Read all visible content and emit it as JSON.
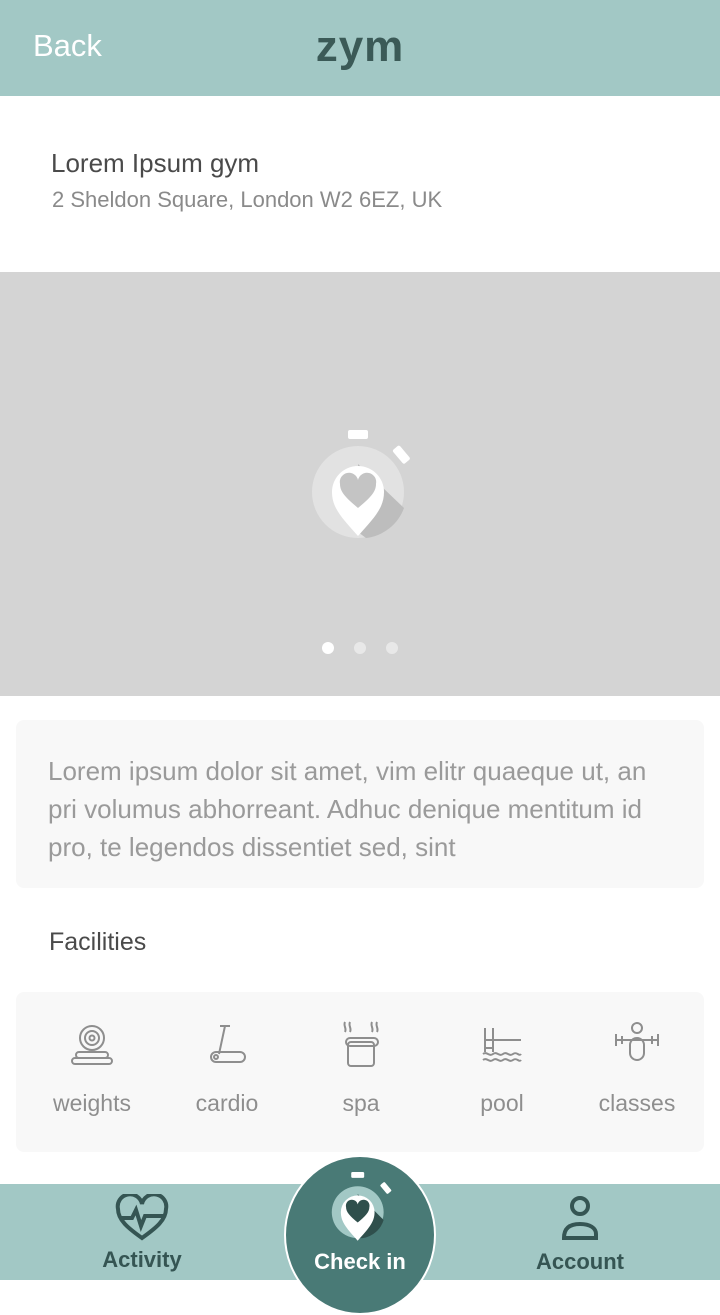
{
  "header": {
    "back_label": "Back",
    "logo": "zym"
  },
  "gym": {
    "name": "Lorem Ipsum gym",
    "address": "2 Sheldon Square, London W2 6EZ, UK"
  },
  "carousel": {
    "icon": "stopwatch-heart-pin-icon",
    "slide_count": 3,
    "active_slide": 1
  },
  "description": "Lorem ipsum dolor sit amet, vim elitr quaeque ut, an pri volumus abhorreant. Adhuc denique mentitum id pro, te legendos dissentiet sed, sint",
  "facilities": {
    "title": "Facilities",
    "items": [
      {
        "label": "weights",
        "icon": "weights-icon"
      },
      {
        "label": "cardio",
        "icon": "treadmill-icon"
      },
      {
        "label": "spa",
        "icon": "spa-icon"
      },
      {
        "label": "pool",
        "icon": "pool-icon"
      },
      {
        "label": "classes",
        "icon": "classes-icon"
      }
    ]
  },
  "nav": {
    "activity": "Activity",
    "checkin": "Check in",
    "account": "Account"
  },
  "colors": {
    "header": "#a2c8c5",
    "dark_teal": "#355553",
    "checkin": "#497a76"
  }
}
